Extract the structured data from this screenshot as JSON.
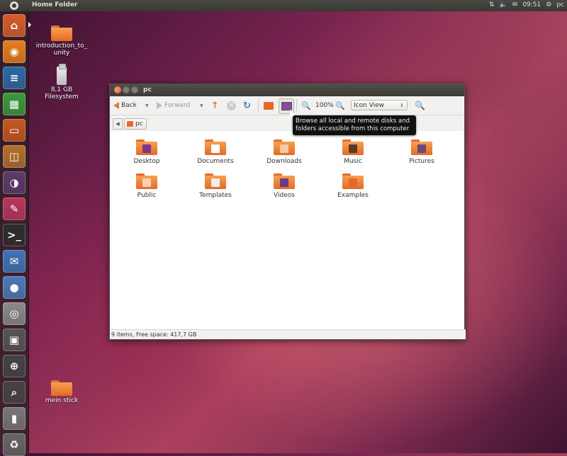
{
  "panel": {
    "title": "Home Folder",
    "time": "09:51",
    "user": "pc",
    "icons": [
      "network-icon",
      "volume-icon",
      "mail-icon"
    ]
  },
  "launcher": {
    "items": [
      {
        "name": "home-folder-launcher",
        "icon": "home-icon",
        "color": "#d65e2a"
      },
      {
        "name": "firefox-launcher",
        "icon": "firefox-icon",
        "color": "#e87d1e"
      },
      {
        "name": "libreoffice-writer-launcher",
        "icon": "writer-icon",
        "color": "#2b6aa5"
      },
      {
        "name": "libreoffice-calc-launcher",
        "icon": "calc-icon",
        "color": "#3a9a3a"
      },
      {
        "name": "libreoffice-impress-launcher",
        "icon": "impress-icon",
        "color": "#c4581f"
      },
      {
        "name": "software-center-launcher",
        "icon": "software-center-icon",
        "color": "#b2702c"
      },
      {
        "name": "workspace-switcher-launcher",
        "icon": "workspaces-icon",
        "color": "#5d3a6a"
      },
      {
        "name": "system-settings-launcher",
        "icon": "settings-icon",
        "color": "#b8365a"
      },
      {
        "name": "terminal-launcher",
        "icon": "terminal-icon",
        "color": "#2d2d2d"
      },
      {
        "name": "thunderbird-launcher",
        "icon": "thunderbird-icon",
        "color": "#3f74b4"
      },
      {
        "name": "empathy-launcher",
        "icon": "chat-icon",
        "color": "#4a7bb8"
      },
      {
        "name": "camera-launcher",
        "icon": "camera-icon",
        "color": "#8a8a8a"
      },
      {
        "name": "screenshot-launcher",
        "icon": "screenshot-icon",
        "color": "#555555"
      },
      {
        "name": "magnifier-launcher",
        "icon": "zoom-icon",
        "color": "#444444"
      },
      {
        "name": "search-launcher",
        "icon": "search-icon",
        "color": "#444444"
      },
      {
        "name": "usb-drive-launcher",
        "icon": "usb-drive-icon",
        "color": "#777777"
      },
      {
        "name": "trash-launcher",
        "icon": "trash-icon",
        "color": "#666666"
      }
    ]
  },
  "desktop": {
    "icons": [
      {
        "label": "introduction_to_unity",
        "type": "folder"
      },
      {
        "label": "8,1 GB Filesystem",
        "type": "usb"
      },
      {
        "label": "mein stick",
        "type": "folder"
      }
    ]
  },
  "window": {
    "title": "pc",
    "toolbar": {
      "back": "Back",
      "forward": "Forward",
      "zoom": "100%",
      "view": "Icon View"
    },
    "path": {
      "current": "pc"
    },
    "folders": [
      {
        "label": "Desktop",
        "emblem": "#7a3a8a"
      },
      {
        "label": "Documents",
        "emblem": "#ffffff"
      },
      {
        "label": "Downloads",
        "emblem": "#f6c9a5"
      },
      {
        "label": "Music",
        "emblem": "#5a3a20"
      },
      {
        "label": "Pictures",
        "emblem": "#6a4a7a"
      },
      {
        "label": "Public",
        "emblem": "#f6d0b0"
      },
      {
        "label": "Templates",
        "emblem": "#eeeeee"
      },
      {
        "label": "Videos",
        "emblem": "#6a3a8a"
      },
      {
        "label": "Examples",
        "emblem": "#e36a27"
      }
    ],
    "status": "9 items, Free space: 417,7 GB"
  },
  "tooltip": {
    "line1": "Browse all local and remote disks and",
    "line2": "folders accessible from this computer"
  }
}
